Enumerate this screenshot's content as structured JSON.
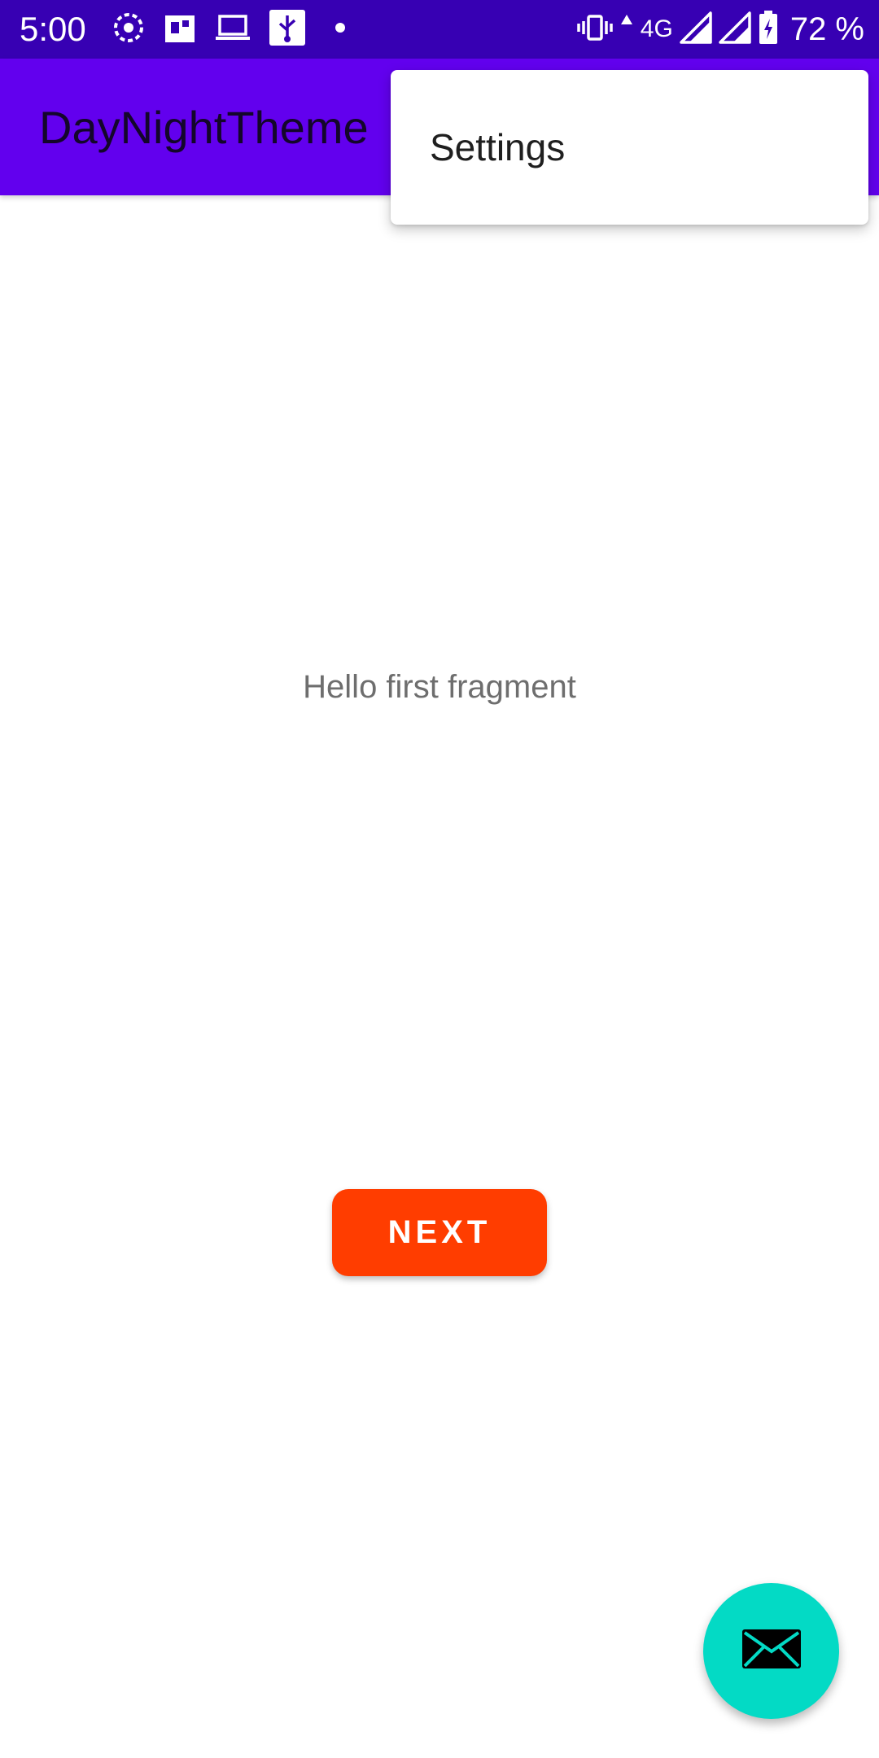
{
  "status_bar": {
    "time": "5:00",
    "network": "4G",
    "battery_percent": "72 %",
    "left_icons": [
      "pinwheel-icon",
      "bag-icon",
      "laptop-icon",
      "usb-icon",
      "dot-icon"
    ],
    "right_icons": [
      "vibrate-icon",
      "data-arrow-icon",
      "signal-icon",
      "signal-icon",
      "battery-charging-icon"
    ],
    "background": "#3700B3"
  },
  "app_bar": {
    "title": "DayNightTheme",
    "background": "#6200EE"
  },
  "overflow_menu": {
    "items": [
      {
        "label": "Settings"
      }
    ]
  },
  "content": {
    "message": "Hello first fragment",
    "next_button_label": "NEXT",
    "next_button_color": "#FF3D00"
  },
  "fab": {
    "icon": "mail-icon",
    "color": "#03DAC5"
  }
}
